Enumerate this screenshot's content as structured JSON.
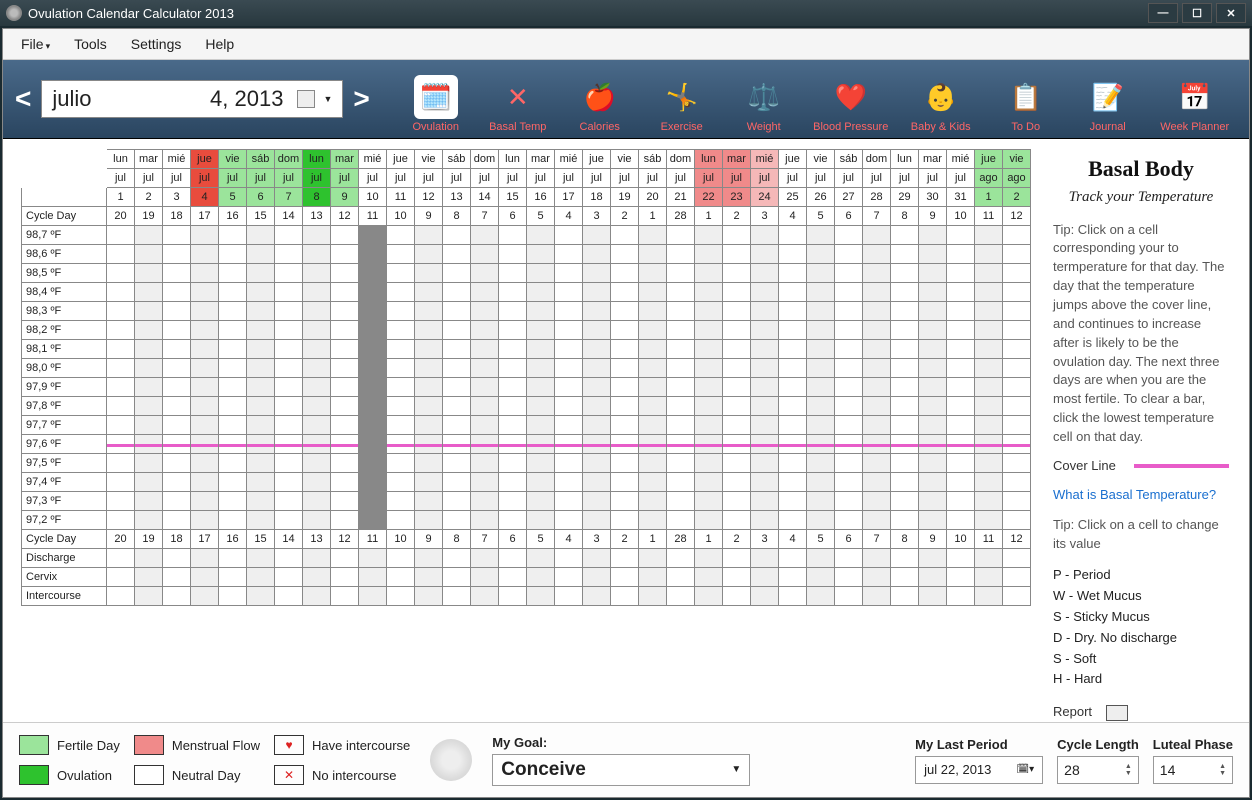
{
  "window": {
    "title": "Ovulation Calendar Calculator 2013"
  },
  "menu": {
    "file": "File",
    "tools": "Tools",
    "settings": "Settings",
    "help": "Help"
  },
  "date_nav": {
    "month": "julio",
    "day_year": "4, 2013"
  },
  "toolbar": {
    "ovulation": "Ovulation",
    "basal": "Basal Temp",
    "calories": "Calories",
    "exercise": "Exercise",
    "weight": "Weight",
    "bp": "Blood Pressure",
    "baby": "Baby & Kids",
    "todo": "To Do",
    "journal": "Journal",
    "planner": "Week Planner"
  },
  "grid": {
    "header_days": [
      {
        "dow": "lun",
        "mon": "jul",
        "num": "1",
        "cls": ""
      },
      {
        "dow": "mar",
        "mon": "jul",
        "num": "2",
        "cls": ""
      },
      {
        "dow": "mié",
        "mon": "jul",
        "num": "3",
        "cls": ""
      },
      {
        "dow": "jue",
        "mon": "jul",
        "num": "4",
        "cls": "today"
      },
      {
        "dow": "vie",
        "mon": "jul",
        "num": "5",
        "cls": "fertile"
      },
      {
        "dow": "sáb",
        "mon": "jul",
        "num": "6",
        "cls": "fertile"
      },
      {
        "dow": "dom",
        "mon": "jul",
        "num": "7",
        "cls": "fertile"
      },
      {
        "dow": "lun",
        "mon": "jul",
        "num": "8",
        "cls": "ovul"
      },
      {
        "dow": "mar",
        "mon": "jul",
        "num": "9",
        "cls": "fertile"
      },
      {
        "dow": "mié",
        "mon": "jul",
        "num": "10",
        "cls": ""
      },
      {
        "dow": "jue",
        "mon": "jul",
        "num": "11",
        "cls": ""
      },
      {
        "dow": "vie",
        "mon": "jul",
        "num": "12",
        "cls": ""
      },
      {
        "dow": "sáb",
        "mon": "jul",
        "num": "13",
        "cls": ""
      },
      {
        "dow": "dom",
        "mon": "jul",
        "num": "14",
        "cls": ""
      },
      {
        "dow": "lun",
        "mon": "jul",
        "num": "15",
        "cls": ""
      },
      {
        "dow": "mar",
        "mon": "jul",
        "num": "16",
        "cls": ""
      },
      {
        "dow": "mié",
        "mon": "jul",
        "num": "17",
        "cls": ""
      },
      {
        "dow": "jue",
        "mon": "jul",
        "num": "18",
        "cls": ""
      },
      {
        "dow": "vie",
        "mon": "jul",
        "num": "19",
        "cls": ""
      },
      {
        "dow": "sáb",
        "mon": "jul",
        "num": "20",
        "cls": ""
      },
      {
        "dow": "dom",
        "mon": "jul",
        "num": "21",
        "cls": ""
      },
      {
        "dow": "lun",
        "mon": "jul",
        "num": "22",
        "cls": "mens"
      },
      {
        "dow": "mar",
        "mon": "jul",
        "num": "23",
        "cls": "mens"
      },
      {
        "dow": "mié",
        "mon": "jul",
        "num": "24",
        "cls": "mens2"
      },
      {
        "dow": "jue",
        "mon": "jul",
        "num": "25",
        "cls": ""
      },
      {
        "dow": "vie",
        "mon": "jul",
        "num": "26",
        "cls": ""
      },
      {
        "dow": "sáb",
        "mon": "jul",
        "num": "27",
        "cls": ""
      },
      {
        "dow": "dom",
        "mon": "jul",
        "num": "28",
        "cls": ""
      },
      {
        "dow": "lun",
        "mon": "jul",
        "num": "29",
        "cls": ""
      },
      {
        "dow": "mar",
        "mon": "jul",
        "num": "30",
        "cls": ""
      },
      {
        "dow": "mié",
        "mon": "jul",
        "num": "31",
        "cls": ""
      },
      {
        "dow": "jue",
        "mon": "ago",
        "num": "1",
        "cls": "fertile"
      },
      {
        "dow": "vie",
        "mon": "ago",
        "num": "2",
        "cls": "fertile"
      }
    ],
    "cycle_label": "Cycle Day",
    "cycle_days": [
      "20",
      "19",
      "18",
      "17",
      "16",
      "15",
      "14",
      "13",
      "12",
      "11",
      "10",
      "9",
      "8",
      "7",
      "6",
      "5",
      "4",
      "3",
      "2",
      "1",
      "28",
      "1",
      "2",
      "3",
      "4",
      "5",
      "6",
      "7",
      "8",
      "9",
      "10",
      "11",
      "12"
    ],
    "temp_labels": [
      "98,7 ºF",
      "98,6 ºF",
      "98,5 ºF",
      "98,4 ºF",
      "98,3 ºF",
      "98,2 ºF",
      "98,1 ºF",
      "98,0 ºF",
      "97,9 ºF",
      "97,8 ºF",
      "97,7 ºF",
      "97,6 ºF",
      "97,5 ºF",
      "97,4 ºF",
      "97,3 ºF",
      "97,2 ºF"
    ],
    "cover_line_temp_index": 11,
    "today_col_index": 9,
    "discharge": "Discharge",
    "cervix": "Cervix",
    "intercourse": "Intercourse"
  },
  "sidebar": {
    "title": "Basal Body",
    "subtitle": "Track your Temperature",
    "tip1": "Tip: Click on a cell corresponding your to termperature for that day. The day that the temperature jumps above the cover line, and continues to  increase after is likely to be the ovulation day. The next three days are  when you are the most fertile. To clear a bar, click the lowest temperature cell on that day.",
    "cover": "Cover Line",
    "link": "What is Basal Temperature?",
    "tip2": "Tip: Click on a cell to change its value",
    "legend": [
      "P  -  Period",
      "W -  Wet Mucus",
      "S  -  Sticky Mucus",
      "D  -  Dry. No discharge",
      "S - Soft",
      "H - Hard"
    ],
    "report": "Report"
  },
  "footer": {
    "fertile": "Fertile Day",
    "menstrual": "Menstrual Flow",
    "have": "Have intercourse",
    "ovulation": "Ovulation",
    "neutral": "Neutral Day",
    "no": "No intercourse",
    "goal_label": "My Goal:",
    "goal_value": "Conceive",
    "last_label": "My Last Period",
    "last_value": "jul  22, 2013",
    "cycle_label": "Cycle Length",
    "cycle_value": "28",
    "luteal_label": "Luteal Phase",
    "luteal_value": "14"
  }
}
